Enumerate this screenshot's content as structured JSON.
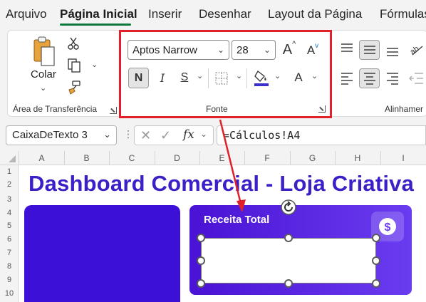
{
  "menu": {
    "items": [
      "Arquivo",
      "Página Inicial",
      "Inserir",
      "Desenhar",
      "Layout da Página",
      "Fórmulas"
    ],
    "active": "Página Inicial"
  },
  "ribbon": {
    "clipboard": {
      "paste_label": "Colar",
      "group_label": "Área de Transferência"
    },
    "font": {
      "font_name": "Aptos Narrow",
      "font_size": "28",
      "bold_label": "N",
      "italic_label": "I",
      "strike_label": "S",
      "font_color_label": "A",
      "grow_label": "A",
      "shrink_label": "A",
      "group_label": "Fonte",
      "highlight_color": "#e0202a",
      "fill_color": "#ffd700",
      "font_color": "#3b2fc9"
    },
    "alignment": {
      "group_label": "Alinhamer"
    }
  },
  "formula_bar": {
    "name_box": "CaixaDeTexto 3",
    "fx_label": "fx",
    "formula": "=Cálculos!A4"
  },
  "grid": {
    "columns": [
      "A",
      "B",
      "C",
      "D",
      "E",
      "F",
      "G",
      "H",
      "I"
    ],
    "rows": [
      "1",
      "2",
      "3",
      "4",
      "5",
      "6",
      "7",
      "8",
      "9",
      "10"
    ]
  },
  "dashboard": {
    "title": "Dashboard Comercial - Loja Criativa",
    "card_title": "Receita Total",
    "title_color": "#3b1fc7",
    "card_color": "#4a12d4"
  }
}
